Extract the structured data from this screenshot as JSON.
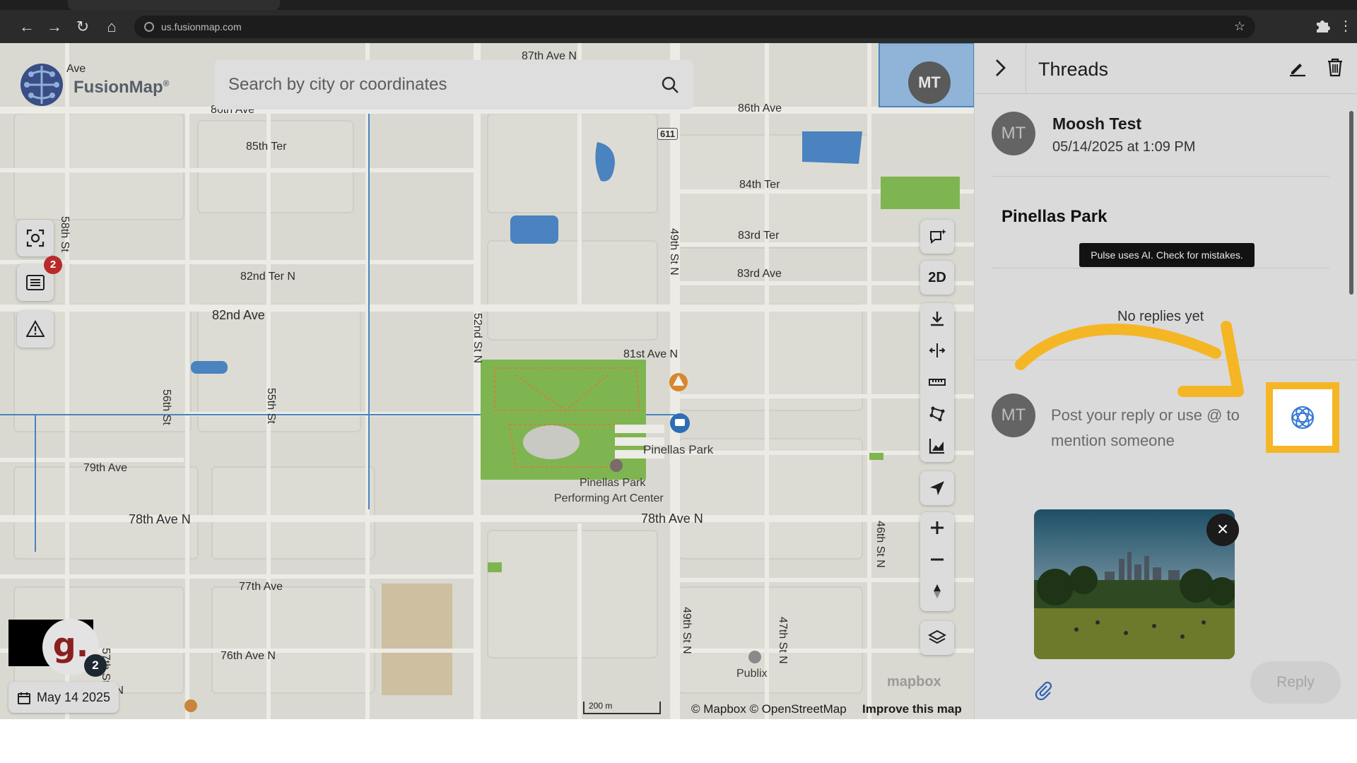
{
  "browser": {
    "url": "us.fusionmap.com",
    "nav": {
      "back": "←",
      "forward": "→",
      "reload": "↻",
      "home": "⌂"
    },
    "star": "☆",
    "extensions_icon": "puzzle-icon",
    "menu": "⋮"
  },
  "app": {
    "brand": "FusionMap",
    "brand_mark": "®"
  },
  "search": {
    "placeholder": "Search by city or coordinates"
  },
  "map": {
    "streets": {
      "s87thAveN": "87th Ave N",
      "s86thAveW": "86th Ave",
      "s86thAveE": "86th Ave",
      "s85thTer": "85th Ter",
      "s84thTer": "84th Ter",
      "s83rdTer": "83rd Ter",
      "s83rdAve": "83rd Ave",
      "s82ndTerN": "82nd Ter N",
      "s82ndAve": "82nd Ave",
      "s81stAveN": "81st Ave N",
      "s79thAve": "79th Ave",
      "s78thAveNW": "78th Ave N",
      "s78thAveNE": "78th Ave N",
      "s77thAve": "77th Ave",
      "s76thAveN": "76th Ave N",
      "sVeN": "ve N",
      "sAve": "Ave",
      "s58thSt": "58th St",
      "s56thSt": "56th St",
      "s55thSt": "55th St",
      "s52ndStN": "52nd St N",
      "s49thStN1": "49th St N",
      "s49thStN2": "49th St N",
      "s47thStN": "47th St N",
      "s46thStN": "46th St N",
      "s57thSt": "57th St",
      "s58th": "58th"
    },
    "route_shield": "611",
    "pois": {
      "pinellas": "Pinellas Park",
      "pac1": "Pinellas Park",
      "pac2": "Performing Art Center",
      "publix": "Publix"
    },
    "attribution": {
      "scale": "200 m",
      "copyright": "© Mapbox © OpenStreetMap",
      "improve": "Improve this map"
    },
    "mapbox_logo": "mapbox",
    "avatar_initials": "MT",
    "btn_2d": "2D",
    "alerts_badge": "2"
  },
  "user": {
    "avatar_letter": "g.",
    "notification_count": "2"
  },
  "date_pill": {
    "label": "May 14 2025"
  },
  "panel": {
    "title": "Threads",
    "thread": {
      "avatar": "MT",
      "author": "Moosh Test",
      "timestamp": "05/14/2025 at 1:09 PM",
      "place": "Pinellas Park",
      "ai_notice": "Pulse uses AI. Check for mistakes.",
      "empty": "No replies yet"
    },
    "reply": {
      "avatar": "MT",
      "placeholder": "Post your reply or use @ to mention someone",
      "thumb_close": "×",
      "submit": "Reply"
    }
  },
  "colors": {
    "highlight": "#f5b626",
    "map_bg": "#d9d9d1",
    "park": "#7fb551",
    "water": "#4a83bf",
    "ai_icon": "#3478d6"
  }
}
